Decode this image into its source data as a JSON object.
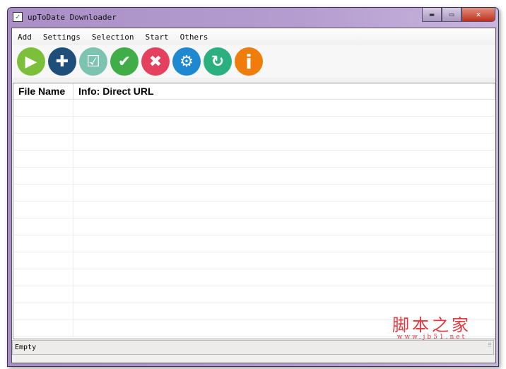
{
  "window": {
    "title": "upToDate Downloader",
    "minimize": "▬",
    "maximize": "▭",
    "close": "✕"
  },
  "menu": [
    "Add",
    "Settings",
    "Selection",
    "Start",
    "Others"
  ],
  "toolbar": [
    {
      "name": "start",
      "icon": "play-icon",
      "glyph": "▶",
      "color": "#7cbf3a"
    },
    {
      "name": "add",
      "icon": "plus-icon",
      "glyph": "✚",
      "color": "#1f4e7a"
    },
    {
      "name": "selection",
      "icon": "checkbox-icon",
      "glyph": "☑",
      "color": "#7cc4b0"
    },
    {
      "name": "confirm",
      "icon": "check-icon",
      "glyph": "✔",
      "color": "#3fae49"
    },
    {
      "name": "remove",
      "icon": "x-icon",
      "glyph": "✖",
      "color": "#e5405e"
    },
    {
      "name": "settings",
      "icon": "gear-icon",
      "glyph": "⚙",
      "color": "#1e88d0"
    },
    {
      "name": "refresh",
      "icon": "refresh-icon",
      "glyph": "↻",
      "color": "#2bb07f"
    },
    {
      "name": "info",
      "icon": "info-icon",
      "glyph": "i",
      "color": "#f07d0a"
    }
  ],
  "table": {
    "columns": [
      "File Name",
      "Info: Direct URL"
    ]
  },
  "status": "Empty",
  "watermark": {
    "cn": "脚本之家",
    "url": "www.jb51.net"
  }
}
